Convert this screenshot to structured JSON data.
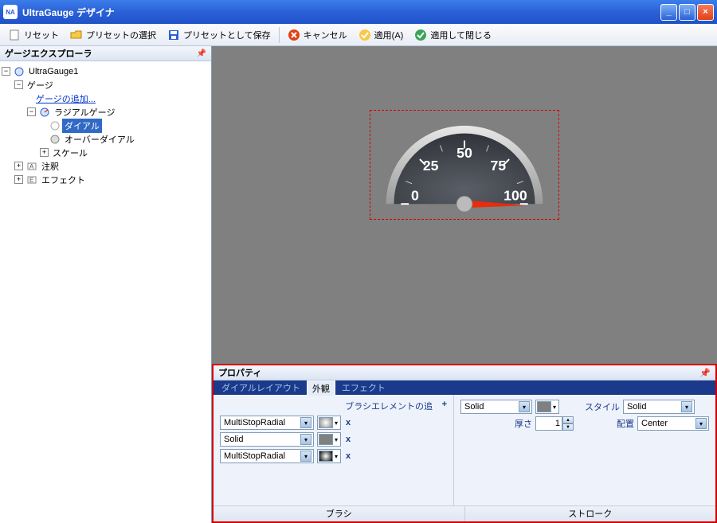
{
  "window": {
    "title": "UltraGauge デザイナ",
    "app_icon": "NA"
  },
  "toolbar": {
    "reset": "リセット",
    "select_preset": "プリセットの選択",
    "save_preset": "プリセットとして保存",
    "cancel": "キャンセル",
    "apply": "適用(A)",
    "apply_close": "適用して閉じる"
  },
  "explorer": {
    "title": "ゲージエクスプローラ",
    "root": "UltraGauge1",
    "gauges": "ゲージ",
    "add_gauge": "ゲージの追加...",
    "radial_gauge": "ラジアルゲージ",
    "dial": "ダイアル",
    "over_dial": "オーバーダイアル",
    "scale": "スケール",
    "annotation": "注釈",
    "effect": "エフェクト"
  },
  "gauge": {
    "ticks": [
      "0",
      "25",
      "50",
      "75",
      "100"
    ]
  },
  "properties": {
    "title": "プロパティ",
    "tabs": {
      "layout": "ダイアルレイアウト",
      "appearance": "外観",
      "effect": "エフェクト"
    },
    "brush_section": "ブラシエレメントの追",
    "brush_rows": [
      {
        "type": "MultiStopRadial",
        "swatch": "radial-gradient(circle,#fff,#888)"
      },
      {
        "type": "Solid",
        "swatch": "#808080"
      },
      {
        "type": "MultiStopRadial",
        "swatch": "radial-gradient(circle,#fff,#000)"
      }
    ],
    "stroke": {
      "type": "Solid",
      "swatch": "#808080",
      "thickness_label": "厚さ",
      "thickness": "1",
      "style_label": "スタイル",
      "style": "Solid",
      "align_label": "配置",
      "align": "Center"
    },
    "footer": {
      "brush": "ブラシ",
      "stroke": "ストローク"
    }
  }
}
